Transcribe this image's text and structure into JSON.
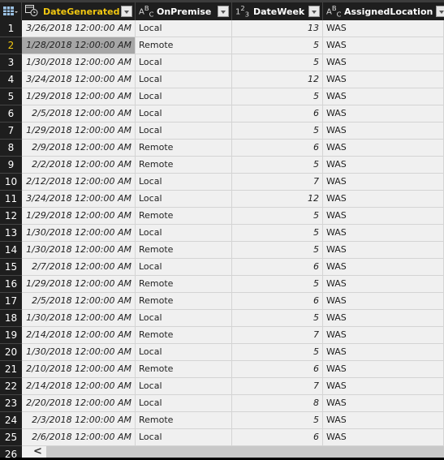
{
  "columns": [
    {
      "name": "DateGenerated",
      "type_icon": "datetime-icon",
      "type_glyph": "▦",
      "highlight": true
    },
    {
      "name": "OnPremise",
      "type_icon": "text-type-icon",
      "type_glyph": "ABC"
    },
    {
      "name": "DateWeek",
      "type_icon": "integer-type-icon",
      "type_glyph": "1²₃"
    },
    {
      "name": "AssignedLocation",
      "type_icon": "text-type-icon",
      "type_glyph": "ABC"
    }
  ],
  "colors": {
    "header_highlight": "#f2c811",
    "selected_cell": "#a6a6a6"
  },
  "selected_row": 2,
  "rows": [
    [
      "1",
      "3/26/2018 12:00:00 AM",
      "Local",
      "13",
      "WAS"
    ],
    [
      "2",
      "1/28/2018 12:00:00 AM",
      "Remote",
      "5",
      "WAS"
    ],
    [
      "3",
      "1/30/2018 12:00:00 AM",
      "Local",
      "5",
      "WAS"
    ],
    [
      "4",
      "3/24/2018 12:00:00 AM",
      "Local",
      "12",
      "WAS"
    ],
    [
      "5",
      "1/29/2018 12:00:00 AM",
      "Local",
      "5",
      "WAS"
    ],
    [
      "6",
      "2/5/2018 12:00:00 AM",
      "Local",
      "6",
      "WAS"
    ],
    [
      "7",
      "1/29/2018 12:00:00 AM",
      "Local",
      "5",
      "WAS"
    ],
    [
      "8",
      "2/9/2018 12:00:00 AM",
      "Remote",
      "6",
      "WAS"
    ],
    [
      "9",
      "2/2/2018 12:00:00 AM",
      "Remote",
      "5",
      "WAS"
    ],
    [
      "10",
      "2/12/2018 12:00:00 AM",
      "Local",
      "7",
      "WAS"
    ],
    [
      "11",
      "3/24/2018 12:00:00 AM",
      "Local",
      "12",
      "WAS"
    ],
    [
      "12",
      "1/29/2018 12:00:00 AM",
      "Remote",
      "5",
      "WAS"
    ],
    [
      "13",
      "1/30/2018 12:00:00 AM",
      "Local",
      "5",
      "WAS"
    ],
    [
      "14",
      "1/30/2018 12:00:00 AM",
      "Remote",
      "5",
      "WAS"
    ],
    [
      "15",
      "2/7/2018 12:00:00 AM",
      "Local",
      "6",
      "WAS"
    ],
    [
      "16",
      "1/29/2018 12:00:00 AM",
      "Remote",
      "5",
      "WAS"
    ],
    [
      "17",
      "2/5/2018 12:00:00 AM",
      "Remote",
      "6",
      "WAS"
    ],
    [
      "18",
      "1/30/2018 12:00:00 AM",
      "Local",
      "5",
      "WAS"
    ],
    [
      "19",
      "2/14/2018 12:00:00 AM",
      "Remote",
      "7",
      "WAS"
    ],
    [
      "20",
      "1/30/2018 12:00:00 AM",
      "Local",
      "5",
      "WAS"
    ],
    [
      "21",
      "2/10/2018 12:00:00 AM",
      "Remote",
      "6",
      "WAS"
    ],
    [
      "22",
      "2/14/2018 12:00:00 AM",
      "Local",
      "7",
      "WAS"
    ],
    [
      "23",
      "2/20/2018 12:00:00 AM",
      "Local",
      "8",
      "WAS"
    ],
    [
      "24",
      "2/3/2018 12:00:00 AM",
      "Remote",
      "5",
      "WAS"
    ],
    [
      "25",
      "2/6/2018 12:00:00 AM",
      "Local",
      "6",
      "WAS"
    ]
  ],
  "partial_row_number": "26",
  "scroll_left_glyph": "<"
}
